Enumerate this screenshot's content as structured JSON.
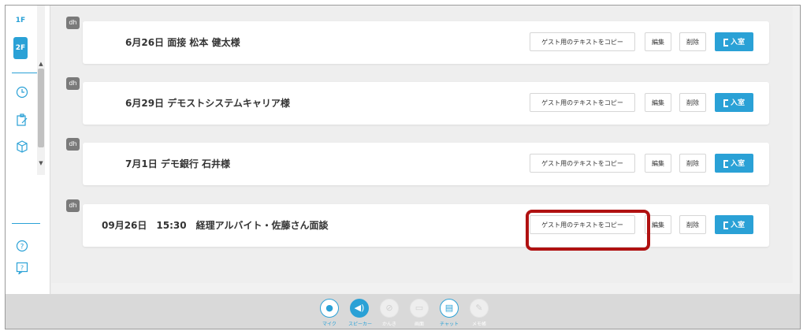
{
  "sidebar": {
    "floors": [
      "1F",
      "2F"
    ],
    "icons": [
      "clock-icon",
      "edit-note-icon",
      "cube-icon",
      "help-icon",
      "question-box-icon"
    ]
  },
  "rooms": [
    {
      "badge": "dh",
      "title": "6月26日 面接 松本 健太様"
    },
    {
      "badge": "dh",
      "title": "6月29日 デモストシステムキャリア様"
    },
    {
      "badge": "dh",
      "title": "7月1日 デモ銀行 石井様"
    },
    {
      "badge": "dh",
      "title": "09月26日　15:30　経理アルバイト・佐藤さん面談"
    }
  ],
  "buttons": {
    "copy": "ゲスト用のテキストをコピー",
    "edit": "編集",
    "delete": "削除",
    "enter": "入室"
  },
  "controls": [
    {
      "label": "マイク",
      "icon": "mic-icon",
      "state": "on-outline"
    },
    {
      "label": "スピーカー",
      "icon": "speaker-icon",
      "state": "active"
    },
    {
      "label": "かんき",
      "icon": "camera-off-icon",
      "state": "disabled"
    },
    {
      "label": "画面",
      "icon": "screen-share-icon",
      "state": "disabled"
    },
    {
      "label": "チャット",
      "icon": "chat-icon",
      "state": "on-outline"
    },
    {
      "label": "メモ帳",
      "icon": "memo-icon",
      "state": "disabled"
    }
  ],
  "colors": {
    "accent": "#2aa1d6",
    "highlight": "#b01111"
  }
}
